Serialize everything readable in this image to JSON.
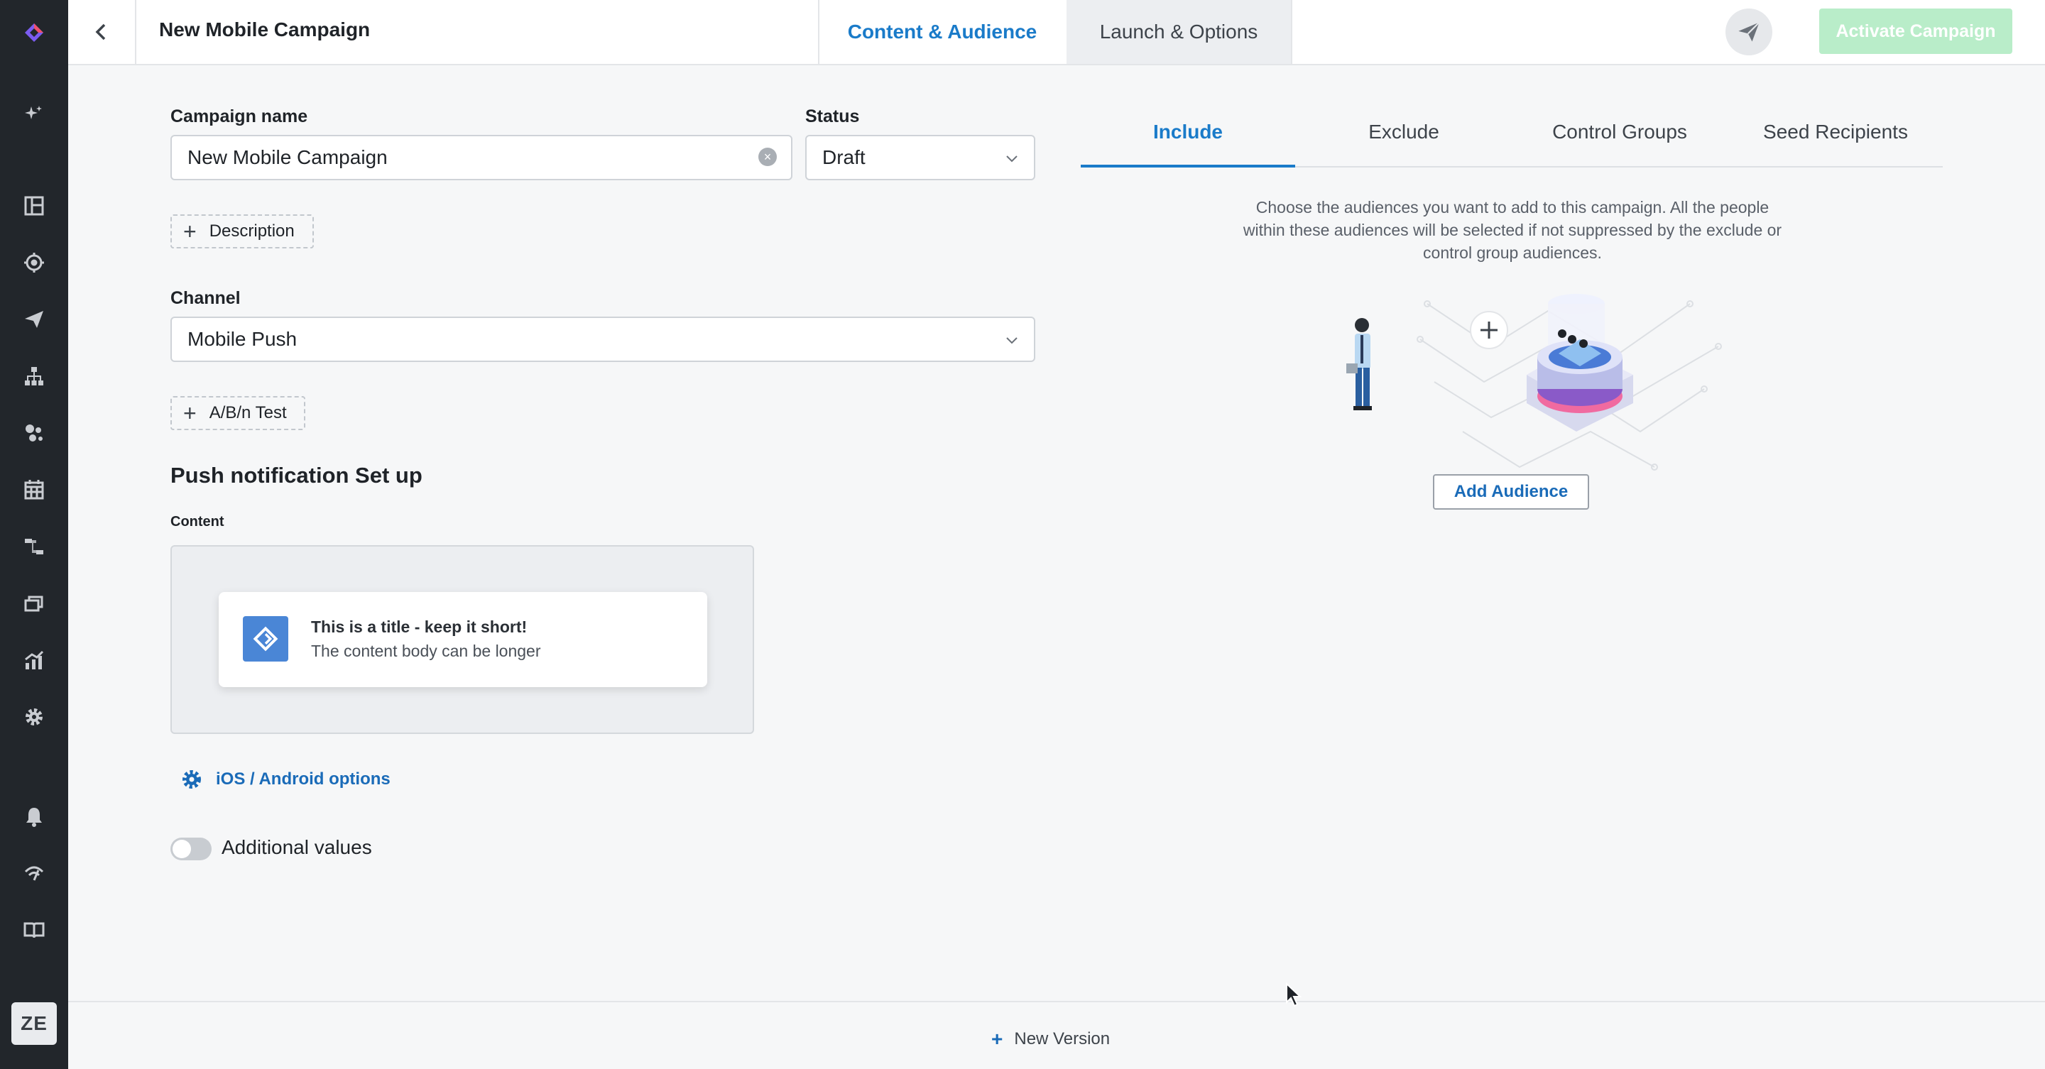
{
  "app": {
    "logo_icon": "brand-diamond-icon",
    "accent_color": "#1a7bc9"
  },
  "header": {
    "back_icon": "chevron-left-icon",
    "title": "New Mobile Campaign",
    "tabs": [
      {
        "label": "Content & Audience",
        "active": true
      },
      {
        "label": "Launch & Options",
        "active": false
      }
    ],
    "send_icon": "paper-plane-icon",
    "activate_label": "Activate Campaign"
  },
  "sidebar": {
    "items": [
      {
        "icon": "sparkle-icon"
      },
      {
        "icon": "dashboard-icon"
      },
      {
        "icon": "target-icon"
      },
      {
        "icon": "send-icon"
      },
      {
        "icon": "hierarchy-icon"
      },
      {
        "icon": "segments-icon"
      },
      {
        "icon": "calendar-icon"
      },
      {
        "icon": "journey-icon"
      },
      {
        "icon": "assets-icon"
      },
      {
        "icon": "analytics-icon"
      },
      {
        "icon": "settings-icon"
      },
      {
        "icon": "bell-icon"
      },
      {
        "icon": "signal-icon"
      },
      {
        "icon": "book-icon"
      }
    ],
    "avatar_initials": "ZE"
  },
  "form": {
    "campaign_name_label": "Campaign name",
    "campaign_name_value": "New Mobile Campaign",
    "status_label": "Status",
    "status_value": "Draft",
    "description_button": "Description",
    "channel_label": "Channel",
    "channel_value": "Mobile Push",
    "ab_test_button": "A/B/n Test",
    "section_title": "Push notification Set up",
    "content_label": "Content",
    "preview_title": "This is a title - keep it short!",
    "preview_body": "The content body can be longer",
    "ios_android_options": "iOS / Android options",
    "additional_values_label": "Additional values",
    "additional_values_on": false
  },
  "audience": {
    "tabs": [
      {
        "label": "Include",
        "active": true
      },
      {
        "label": "Exclude",
        "active": false
      },
      {
        "label": "Control Groups",
        "active": false
      },
      {
        "label": "Seed Recipients",
        "active": false
      }
    ],
    "help_text": "Choose the audiences you want to add to this campaign. All the people within these audiences will be selected if not suppressed by the exclude or control group audiences.",
    "add_audience_button": "Add Audience"
  },
  "footer": {
    "new_version_label": "New Version"
  }
}
